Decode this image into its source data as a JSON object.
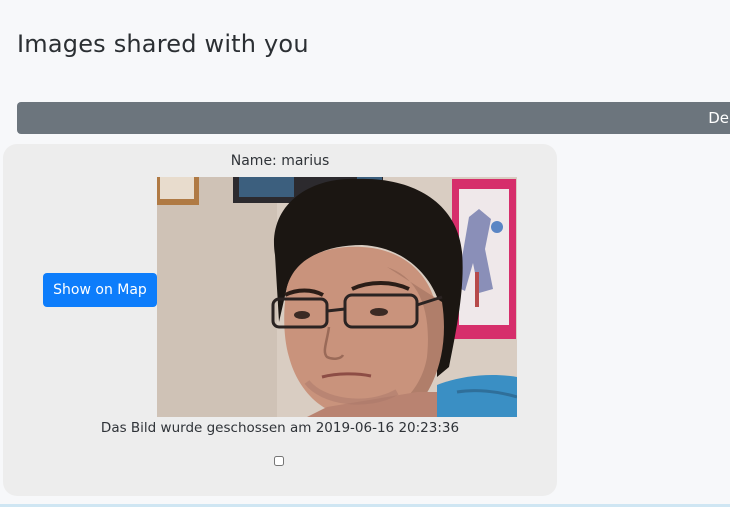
{
  "page": {
    "title": "Images shared with you"
  },
  "top_bar": {
    "label": "De"
  },
  "card": {
    "name_text": "Name: marius",
    "show_map_label": "Show on Map",
    "caption": "Das Bild wurde geschossen am 2019-06-16 20:23:36",
    "checkbox_checked": false,
    "photo_subject": "portrait-photo"
  },
  "colors": {
    "bar_gray": "#6c757d",
    "primary_blue": "#0d7dfb",
    "card_bg": "#ededed",
    "page_bg": "#f7f8fa"
  }
}
